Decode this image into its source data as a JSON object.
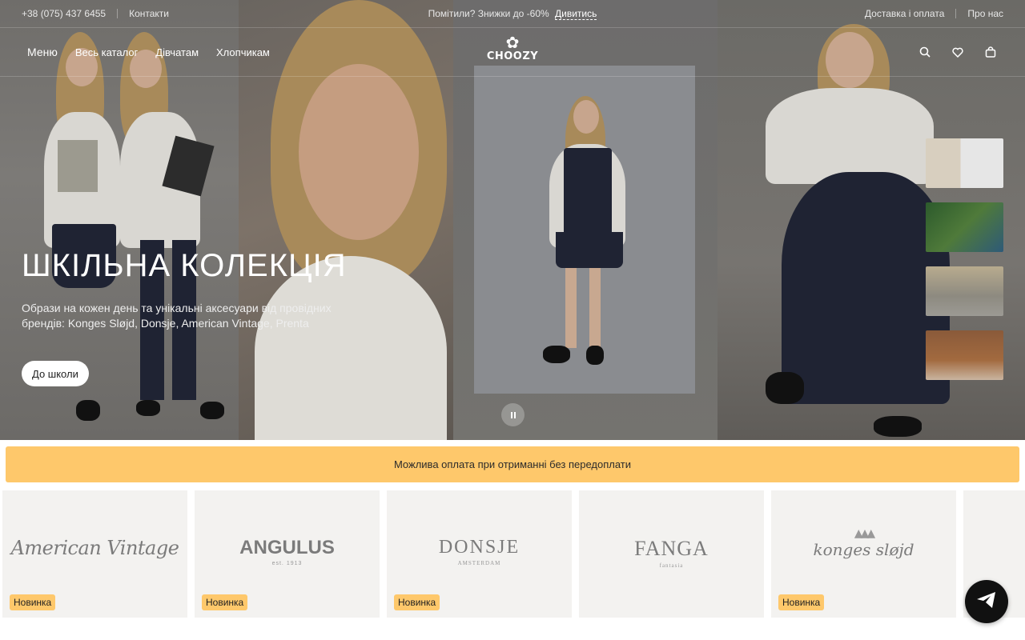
{
  "topbar": {
    "phone": "+38 (075) 437 6455",
    "contacts": "Контакти",
    "promo_text": "Помітили? Знижки до -60%",
    "promo_link": "Дивитись",
    "delivery": "Доставка і оплата",
    "about": "Про нас"
  },
  "nav": {
    "menu": "Меню",
    "catalog": "Весь каталог",
    "girls": "Дівчатам",
    "boys": "Хлопчикам",
    "logo": "CHOOZY",
    "icons": [
      "search-icon",
      "heart-icon",
      "bag-icon"
    ]
  },
  "hero": {
    "title": "ШКІЛЬНА КОЛЕКЦІЯ",
    "subtitle": "Образи на кожен день та унікальні аксесуари від провідних брендів: Konges Sløjd, Donsje, American Vintage, Prenta",
    "button": "До школи"
  },
  "banner": {
    "text": "Можлива оплата при отриманні без передоплати"
  },
  "brands": {
    "items": [
      {
        "logo": "American Vintage",
        "badge": "Новинка"
      },
      {
        "logo": "ANGULUS",
        "tagline": "est. 1913",
        "badge": "Новинка"
      },
      {
        "logo": "DONSJE",
        "tagline": "AMSTERDAM",
        "badge": "Новинка"
      },
      {
        "logo": "FANGA",
        "tagline": "fantasia",
        "badge": ""
      },
      {
        "logo": "konges sløjd",
        "badge": "Новинка"
      }
    ]
  },
  "colors": {
    "accent": "#fec86b",
    "fab": "#111111"
  }
}
